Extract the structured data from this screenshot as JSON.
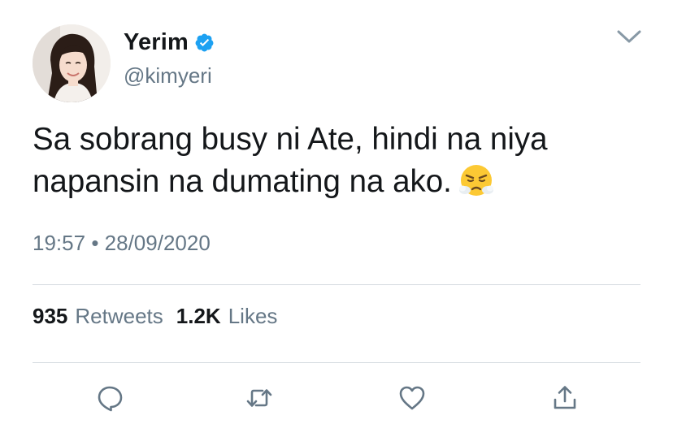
{
  "author": {
    "display_name": "Yerim",
    "handle": "@kimyeri",
    "verified": true
  },
  "tweet": {
    "text": "Sa sobrang busy ni Ate, hindi na niya napansin na dumating na ako.",
    "emoji": "face-with-steam-from-nose-emoji"
  },
  "meta": {
    "time": "19:57",
    "separator": "•",
    "date": "28/09/2020"
  },
  "stats": {
    "retweets_count": "935",
    "retweets_label": "Retweets",
    "likes_count": "1.2K",
    "likes_label": "Likes"
  },
  "actions": [
    "reply-icon",
    "retweet-icon",
    "like-icon",
    "share-icon"
  ],
  "colors": {
    "text_primary": "#14171a",
    "text_secondary": "#657786",
    "verified_blue": "#1da1f2",
    "icon_gray": "#657786",
    "divider": "#d4dadf"
  }
}
